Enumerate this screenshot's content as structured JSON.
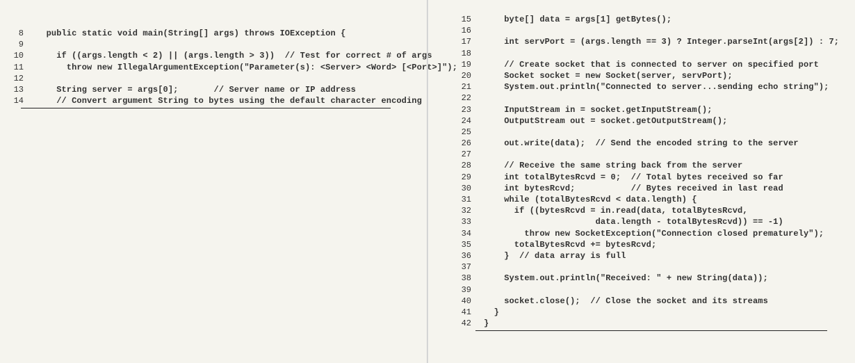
{
  "left": {
    "lines": [
      {
        "n": "8",
        "t": "  public static void main(String[] args) throws IOException {"
      },
      {
        "n": "9",
        "t": ""
      },
      {
        "n": "10",
        "t": "    if ((args.length < 2) || (args.length > 3))  // Test for correct # of args"
      },
      {
        "n": "11",
        "t": "      throw new IllegalArgumentException(\"Parameter(s): <Server> <Word> [<Port>]\");"
      },
      {
        "n": "12",
        "t": ""
      },
      {
        "n": "13",
        "t": "    String server = args[0];       // Server name or IP address"
      },
      {
        "n": "14",
        "t": "    // Convert argument String to bytes using the default character encoding"
      }
    ]
  },
  "right": {
    "lines": [
      {
        "n": "15",
        "t": "    byte[] data = args[1] getBytes();"
      },
      {
        "n": "16",
        "t": ""
      },
      {
        "n": "17",
        "t": "    int servPort = (args.length == 3) ? Integer.parseInt(args[2]) : 7;"
      },
      {
        "n": "18",
        "t": ""
      },
      {
        "n": "19",
        "t": "    // Create socket that is connected to server on specified port"
      },
      {
        "n": "20",
        "t": "    Socket socket = new Socket(server, servPort);"
      },
      {
        "n": "21",
        "t": "    System.out.println(\"Connected to server...sending echo string\");"
      },
      {
        "n": "22",
        "t": ""
      },
      {
        "n": "23",
        "t": "    InputStream in = socket.getInputStream();"
      },
      {
        "n": "24",
        "t": "    OutputStream out = socket.getOutputStream();"
      },
      {
        "n": "25",
        "t": ""
      },
      {
        "n": "26",
        "t": "    out.write(data);  // Send the encoded string to the server"
      },
      {
        "n": "27",
        "t": ""
      },
      {
        "n": "28",
        "t": "    // Receive the same string back from the server"
      },
      {
        "n": "29",
        "t": "    int totalBytesRcvd = 0;  // Total bytes received so far"
      },
      {
        "n": "30",
        "t": "    int bytesRcvd;           // Bytes received in last read"
      },
      {
        "n": "31",
        "t": "    while (totalBytesRcvd < data.length) {"
      },
      {
        "n": "32",
        "t": "      if ((bytesRcvd = in.read(data, totalBytesRcvd,"
      },
      {
        "n": "33",
        "t": "                      data.length - totalBytesRcvd)) == -1)"
      },
      {
        "n": "34",
        "t": "        throw new SocketException(\"Connection closed prematurely\");"
      },
      {
        "n": "35",
        "t": "      totalBytesRcvd += bytesRcvd;"
      },
      {
        "n": "36",
        "t": "    }  // data array is full"
      },
      {
        "n": "37",
        "t": ""
      },
      {
        "n": "38",
        "t": "    System.out.println(\"Received: \" + new String(data));"
      },
      {
        "n": "39",
        "t": ""
      },
      {
        "n": "40",
        "t": "    socket.close();  // Close the socket and its streams"
      },
      {
        "n": "41",
        "t": "  }"
      },
      {
        "n": "42",
        "t": "}"
      }
    ]
  }
}
